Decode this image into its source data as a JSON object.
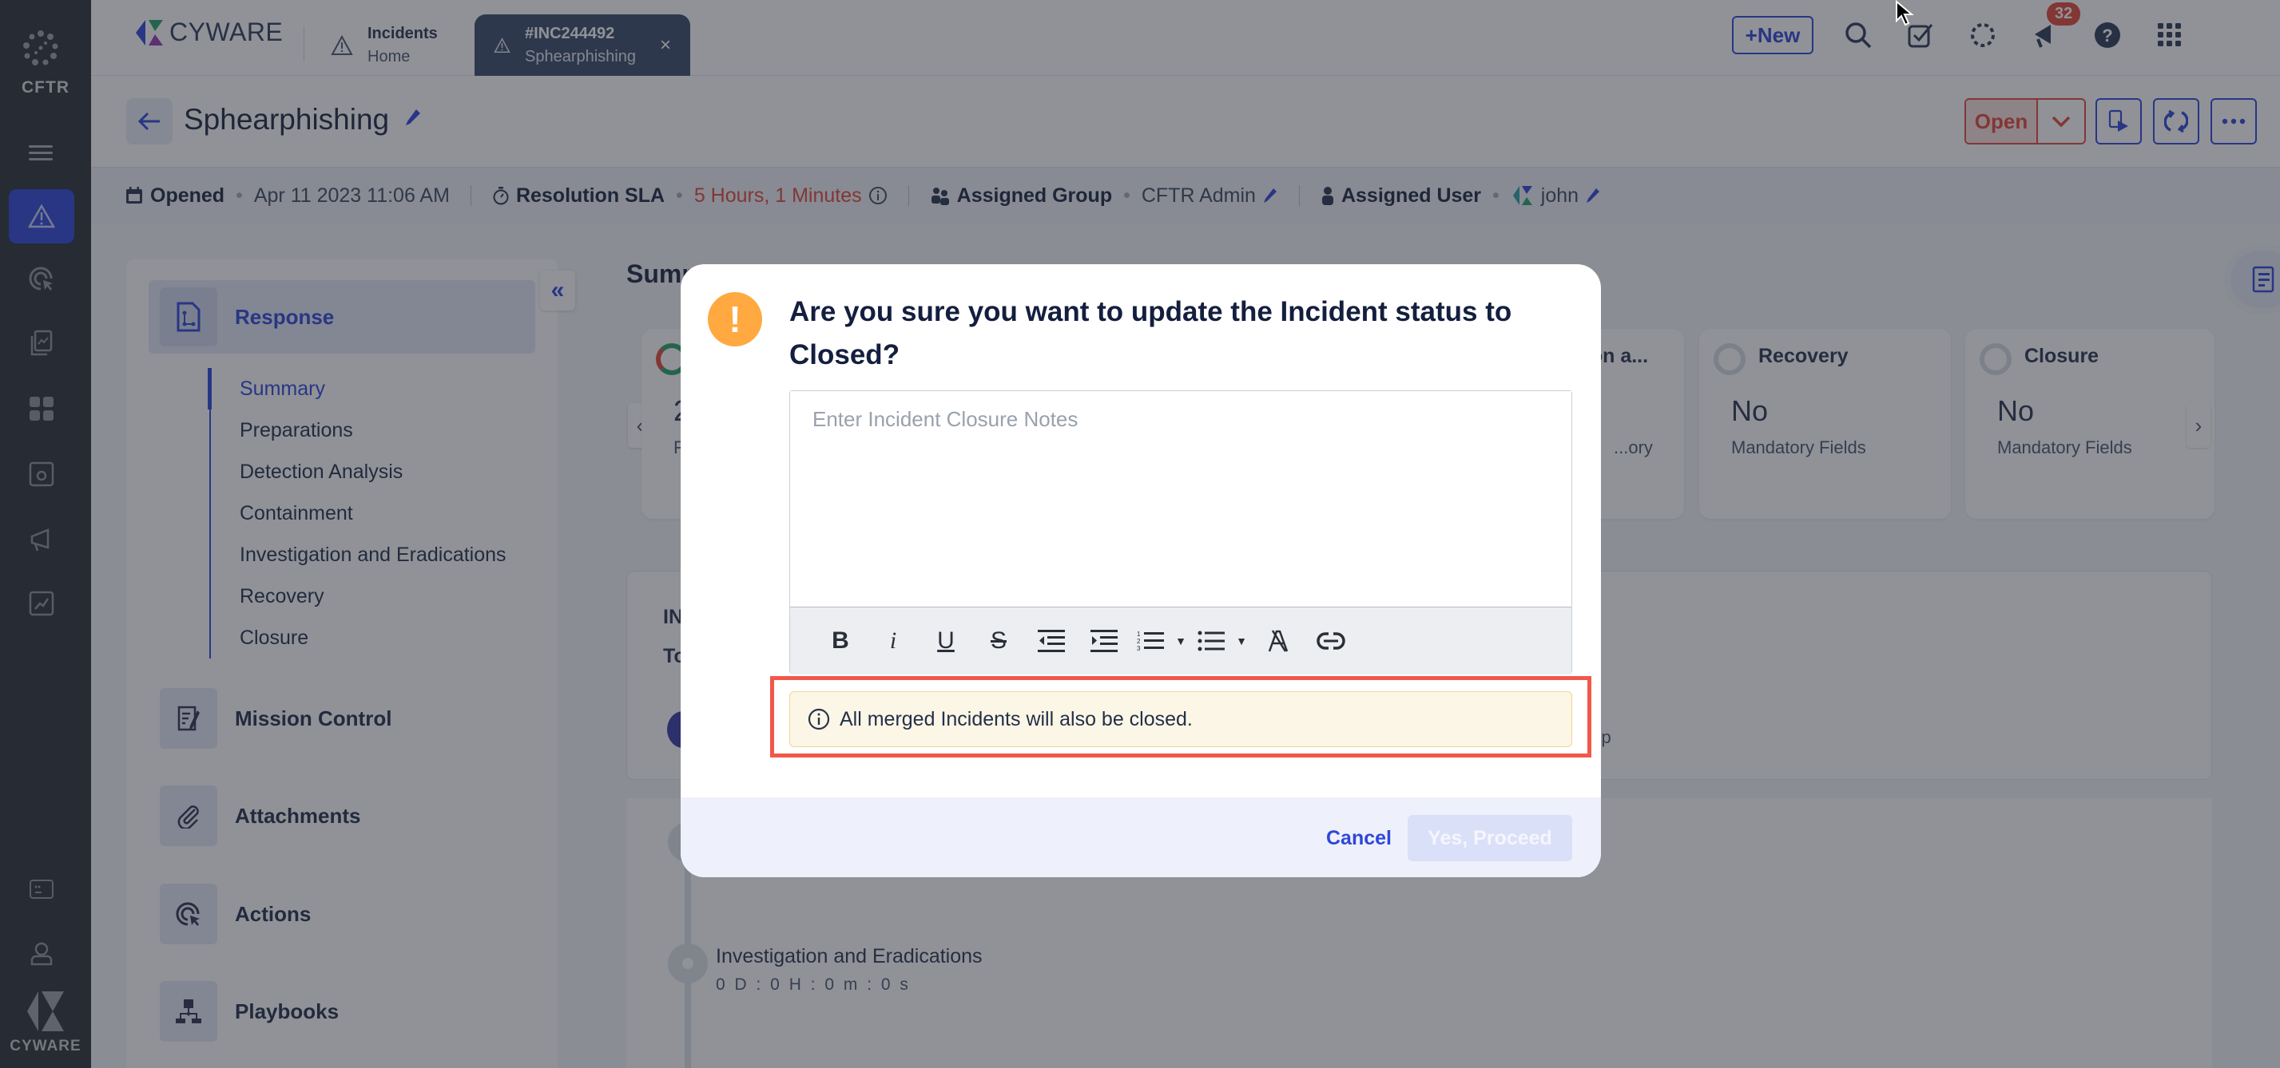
{
  "rail": {
    "tenant": "CFTR",
    "brand": "CYWARE",
    "items": [
      {
        "icon": "incident-warning-icon",
        "active": true
      },
      {
        "icon": "target-cursor-icon"
      },
      {
        "icon": "report-icon"
      },
      {
        "icon": "dashboard-grid-icon"
      },
      {
        "icon": "settings-window-icon"
      },
      {
        "icon": "megaphone-icon"
      },
      {
        "icon": "analytics-icon"
      }
    ],
    "bottom_items": [
      {
        "icon": "id-card-icon"
      },
      {
        "icon": "admin-user-icon"
      }
    ]
  },
  "topbar": {
    "brand": "CYWARE",
    "tabs": [
      {
        "line1": "Incidents",
        "line2": "Home",
        "icon": "warning-icon"
      },
      {
        "line1": "#INC244492",
        "line2": "Sphearphishing",
        "icon": "warning-icon",
        "active": true,
        "close": "×"
      }
    ],
    "new_label": "+New",
    "notification_count": "32",
    "icons": [
      "search-icon",
      "tasks-check-icon",
      "loading-icon",
      "megaphone-icon",
      "help-icon",
      "apps-grid-icon",
      "avatar"
    ]
  },
  "incident": {
    "title": "Sphearphishing",
    "status": "Open",
    "meta": {
      "opened_label": "Opened",
      "opened_value": "Apr 11 2023 11:06 AM",
      "sla_label": "Resolution SLA",
      "sla_value": "5 Hours, 1 Minutes",
      "group_label": "Assigned Group",
      "group_value": "CFTR Admin",
      "user_label": "Assigned User",
      "user_value": "john"
    }
  },
  "leftnav": {
    "response_label": "Response",
    "collapse_label": "«",
    "subitems": [
      "Summary",
      "Preparations",
      "Detection Analysis",
      "Containment",
      "Investigation and Eradications",
      "Recovery",
      "Closure"
    ],
    "active_subitem": "Summary",
    "sections": [
      "Mission Control",
      "Attachments",
      "Actions",
      "Playbooks"
    ]
  },
  "main": {
    "summary_heading": "Summary",
    "phase_cards": [
      {
        "title": "",
        "value": "2",
        "label": "F F"
      },
      {
        "title": "...on a...",
        "value": "",
        "label": "...ory"
      },
      {
        "title": "Recovery",
        "value": "No",
        "label": "Mandatory Fields"
      },
      {
        "title": "Closure",
        "value": "No",
        "label": "Mandatory Fields"
      }
    ],
    "lower_card": {
      "line1": "IN",
      "line2": "To",
      "partial_right": "oup"
    },
    "timeline": [
      {
        "title": "Investigation and Eradications",
        "time": "0 D : 0 H : 0 m : 0 s"
      }
    ]
  },
  "modal": {
    "title": "Are you sure you want to update the Incident status to Closed?",
    "notes_placeholder": "Enter Incident Closure Notes",
    "notes_value": "",
    "toolbar": [
      {
        "name": "bold",
        "glyph": "B"
      },
      {
        "name": "italic",
        "glyph": "i"
      },
      {
        "name": "underline",
        "glyph": "U"
      },
      {
        "name": "strikethrough",
        "glyph": "S"
      },
      {
        "name": "outdent",
        "glyph": "⇤"
      },
      {
        "name": "indent",
        "glyph": "⇥"
      },
      {
        "name": "ordered-list",
        "glyph": "≡"
      },
      {
        "name": "bullet-list",
        "glyph": "≡"
      },
      {
        "name": "clear-format",
        "glyph": "A"
      },
      {
        "name": "link",
        "glyph": "⊖"
      }
    ],
    "notice": "All merged Incidents will also be closed.",
    "cancel_label": "Cancel",
    "proceed_label": "Yes, Proceed"
  },
  "colors": {
    "accent": "#2f47d8",
    "danger": "#e2483b",
    "warning": "#ffa940",
    "highlight_frame": "#f2584a",
    "notice_bg": "#fcf6e6"
  }
}
